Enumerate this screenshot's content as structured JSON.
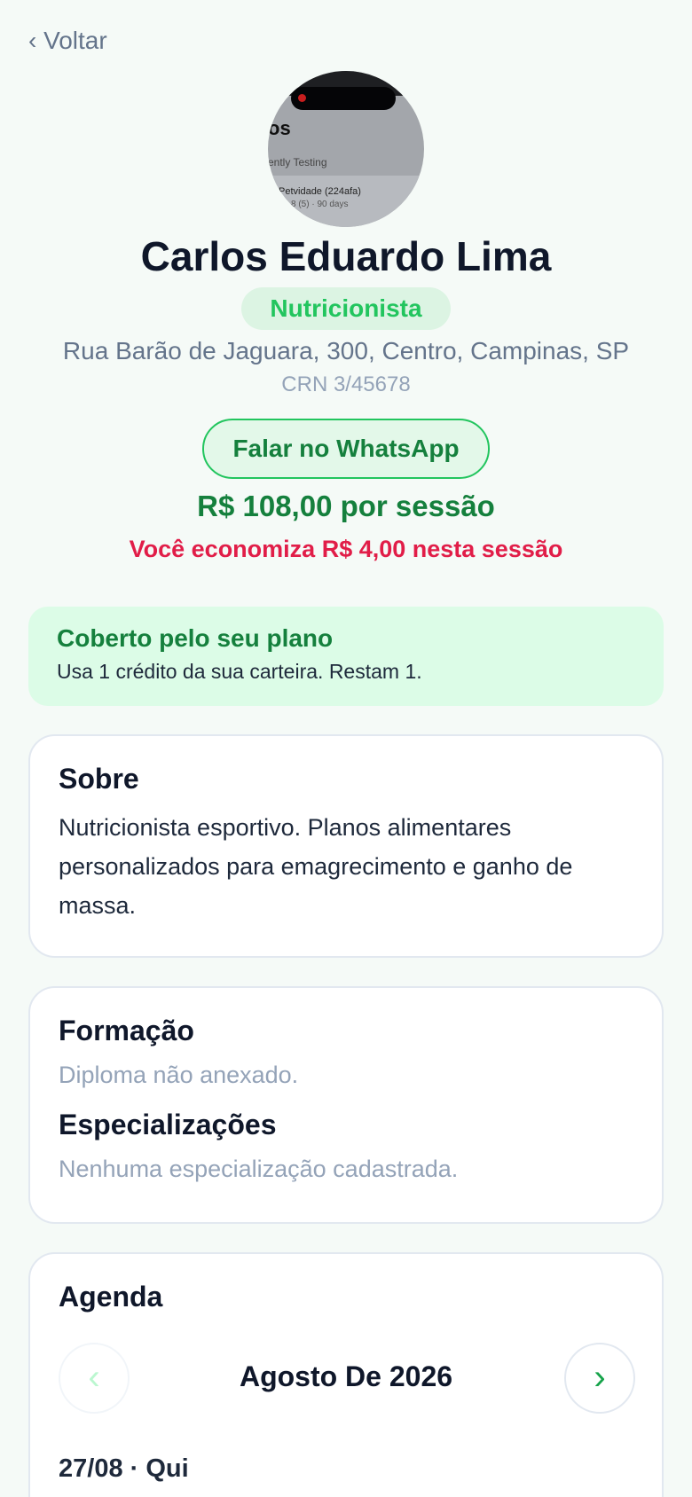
{
  "nav": {
    "back_label": "‹ Voltar"
  },
  "profile": {
    "avatar_texts": [
      "os",
      "ently Testing",
      "Petvidade (224afa)",
      "8 (5) · 90 days"
    ],
    "name": "Carlos Eduardo Lima",
    "role": "Nutricionista",
    "address": "Rua Barão de Jaguara, 300, Centro, Campinas, SP",
    "registration": "CRN 3/45678",
    "whatsapp_label": "Falar no WhatsApp",
    "price": "R$ 108,00 por sessão",
    "saving": "Você economiza R$ 4,00 nesta sessão"
  },
  "coverage": {
    "title": "Coberto pelo seu plano",
    "description": "Usa 1 crédito da sua carteira. Restam 1."
  },
  "about": {
    "title": "Sobre",
    "text": "Nutricionista esportivo. Planos alimentares personalizados para emagrecimento e ganho de massa."
  },
  "education": {
    "title": "Formação",
    "text": "Diploma não anexado.",
    "specialties_title": "Especializações",
    "specialties_text": "Nenhuma especialização cadastrada."
  },
  "agenda": {
    "title": "Agenda",
    "prev_icon": "‹",
    "next_icon": "›",
    "month": "Agosto De 2026",
    "day_label": "27/08 · Qui"
  },
  "colors": {
    "accent_green": "#22c55e",
    "dark_green": "#15803d",
    "saving_red": "#e11d48",
    "background": "#f5faf7"
  }
}
